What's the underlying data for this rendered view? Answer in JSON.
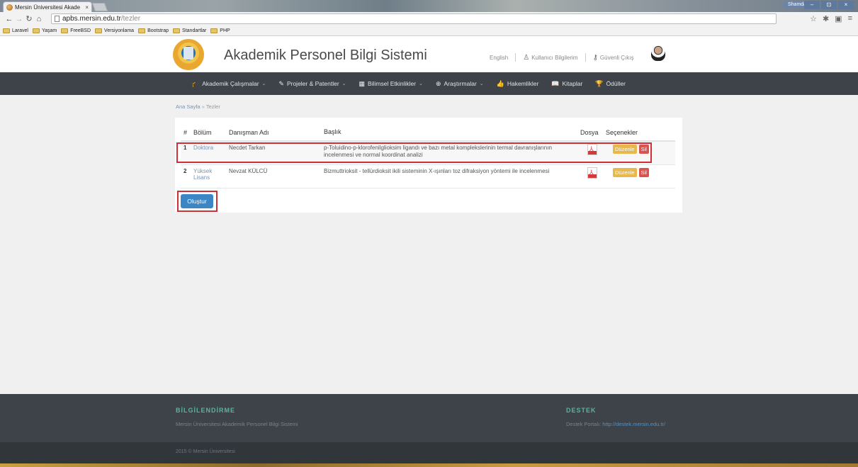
{
  "browser": {
    "tab_title": "Mersin Üniversitesi Akade",
    "tab_close": "×",
    "window_user": "Shamdan",
    "window_buttons": {
      "minimize": "–",
      "restore": "⊡",
      "close": "×"
    },
    "url_host": "apbs.mersin.edu.tr",
    "url_path": "/tezler",
    "bookmarks": [
      "Laravel",
      "Yaşam",
      "FreeBSD",
      "Versiyonlama",
      "Bootstrap",
      "Standartlar",
      "PHP"
    ]
  },
  "header": {
    "title": "Akademik Personel Bilgi Sistemi",
    "english": "English",
    "user_info": "Kullanıcı Bilgilerim",
    "logout": "Güvenli Çıkış"
  },
  "nav": {
    "items": [
      {
        "label": "Akademik Çalışmalar",
        "icon": "graduation-cap-icon",
        "glyph": "🎓",
        "dropdown": true
      },
      {
        "label": "Projeler & Patentler",
        "icon": "pencil-icon",
        "glyph": "✎",
        "dropdown": true
      },
      {
        "label": "Bilimsel Etkinlikler",
        "icon": "calendar-icon",
        "glyph": "▦",
        "dropdown": true
      },
      {
        "label": "Araştırmalar",
        "icon": "globe-icon",
        "glyph": "⊕",
        "dropdown": true
      },
      {
        "label": "Hakemlikler",
        "icon": "thumbs-up-icon",
        "glyph": "👍",
        "dropdown": false
      },
      {
        "label": "Kitaplar",
        "icon": "book-icon",
        "glyph": "📖",
        "dropdown": false
      },
      {
        "label": "Ödüller",
        "icon": "trophy-icon",
        "glyph": "🏆",
        "dropdown": false
      }
    ]
  },
  "breadcrumb": {
    "home": "Ana Sayfa",
    "separator": "»",
    "current": "Tezler"
  },
  "table": {
    "headers": {
      "num": "#",
      "bolum": "Bölüm",
      "danisman": "Danışman Adı",
      "baslik": "Başlık",
      "dosya": "Dosya",
      "secenekler": "Seçenekler"
    },
    "rows": [
      {
        "num": "1",
        "bolum": "Doktora",
        "danisman": "Necdet Tarkan",
        "baslik": "p-Toluidino-p-klorofenilglioksim ligandı ve bazı metal komplekslerinin termal davranışlarının incelenmesi ve normal koordinat analizi",
        "edit": "Düzenle",
        "delete": "Sil"
      },
      {
        "num": "2",
        "bolum": "Yüksek Lisans",
        "danisman": "Nevzat KÜLCÜ",
        "baslik": "Bizmuttrioksit - tellürdioksit ikili sisteminin X-ışınları toz difraksiyon yöntemi ile incelenmesi",
        "edit": "Düzenle",
        "delete": "Sil"
      }
    ],
    "pdf_label": "PDF"
  },
  "create_button": "Oluştur",
  "footer": {
    "info_title": "BİLGİLENDİRME",
    "info_text": "Mersin Üniversitesi Akademik Personel Bilgi Sistemi",
    "support_title": "DESTEK",
    "support_prefix": "Destek Portalı:",
    "support_link": "http://destek.mersin.edu.tr/",
    "copyright": "2015 © Mersin Üniversitesi"
  },
  "colors": {
    "nav_bg": "#3d4348",
    "accent_green": "#5db39a",
    "primary_blue": "#3d86c6",
    "highlight_red": "#d02f36",
    "edit_orange": "#e8b84a",
    "delete_red": "#d9534f"
  }
}
